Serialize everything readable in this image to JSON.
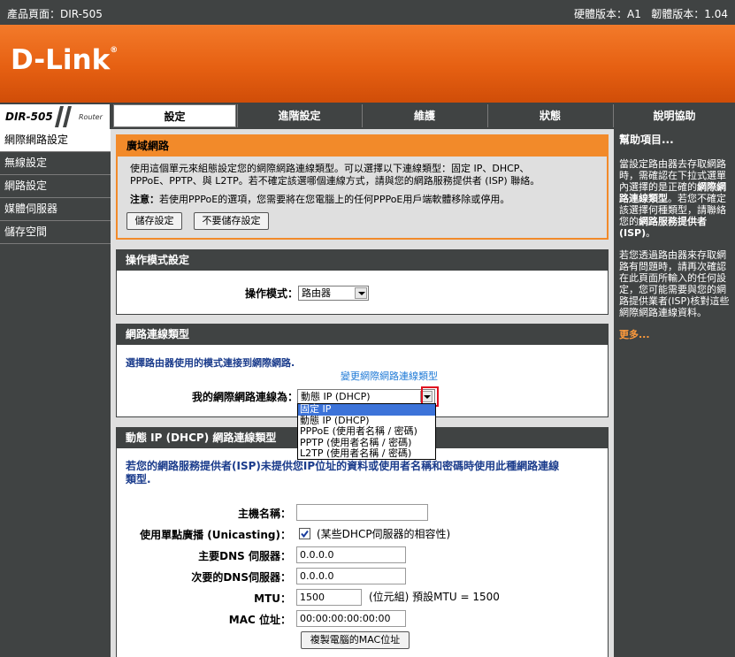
{
  "topbar": {
    "product_page": "產品頁面：DIR-505",
    "versions": "硬體版本：A1   韌體版本：1.04"
  },
  "brand": {
    "logo": "D-Link",
    "trademark": "®"
  },
  "model": {
    "name": "DIR-505",
    "subtitle": "Router"
  },
  "tabs": [
    {
      "label": "設定",
      "active": true
    },
    {
      "label": "進階設定",
      "active": false
    },
    {
      "label": "維護",
      "active": false
    },
    {
      "label": "狀態",
      "active": false
    },
    {
      "label": "說明協助",
      "active": false
    }
  ],
  "sidebar": {
    "items": [
      {
        "label": "網際網路設定",
        "active": true
      },
      {
        "label": "無線設定",
        "active": false
      },
      {
        "label": "網路設定",
        "active": false
      },
      {
        "label": "媒體伺服器",
        "active": false
      },
      {
        "label": "儲存空間",
        "active": false
      }
    ]
  },
  "wan": {
    "title": "廣域網路",
    "desc1": "使用這個單元來組態設定您的網際網路連線類型。可以選擇以下連線類型：固定 IP、DHCP、",
    "desc2": "PPPoE、PPTP、與 L2TP。若不確定該選哪個連線方式，請與您的網路服務提供者 (ISP) 聯絡。",
    "note_label": "注意：",
    "note_text": "若使用PPPoE的選項，您需要將在您電腦上的任何PPPoE用戶端軟體移除或停用。",
    "save_label": "儲存設定",
    "dont_save_label": "不要儲存設定"
  },
  "mode": {
    "title": "操作模式設定",
    "label": "操作模式：",
    "value": "路由器"
  },
  "conn": {
    "title": "網路連線類型",
    "desc": "選擇路由器使用的模式連接到網際網路.",
    "change_link": "變更網際網路連線類型",
    "label": "我的網際網路連線為：",
    "value": "動態 IP (DHCP)",
    "options": [
      {
        "label": "固定 IP",
        "highlighted": true
      },
      {
        "label": "動態 IP (DHCP)",
        "highlighted": false
      },
      {
        "label": "PPPoE (使用者名稱 / 密碼)",
        "highlighted": false
      },
      {
        "label": "PPTP (使用者名稱 / 密碼)",
        "highlighted": false
      },
      {
        "label": "L2TP (使用者名稱 / 密碼)",
        "highlighted": false
      }
    ]
  },
  "dhcp": {
    "title": "動態 IP (DHCP) 網路連線類型",
    "desc1": "若您的網路服務提供者(ISP)未提供您IP位址的資料或使用者名稱和密碼時使用此種網路連線",
    "desc2": "類型.",
    "host_label": "主機名稱：",
    "host_value": "",
    "unicast_label": "使用單點廣播 (Unicasting)：",
    "unicast_checked": true,
    "unicast_note": "(某些DHCP伺服器的相容性)",
    "dns1_label": "主要DNS 伺服器：",
    "dns1_value": "0.0.0.0",
    "dns2_label": "次要的DNS伺服器：",
    "dns2_value": "0.0.0.0",
    "mtu_label": "MTU：",
    "mtu_value": "1500",
    "mtu_note": "(位元組) 預設MTU = 1500",
    "mac_label": "MAC 位址：",
    "mac_value": "00:00:00:00:00:00",
    "clone_label": "複製電腦的MAC位址"
  },
  "help": {
    "title": "幫助項目...",
    "p1a": "當設定路由器去存取網路時，需確認在下拉式選單內選擇的是正確的",
    "p1b": "網際網路連線類型",
    "p1c": "。若您不確定該選擇何種類型，請聯絡您的",
    "p1d": "網路服務提供者(ISP)",
    "p1e": "。",
    "p2": "若您透過路由器來存取網路有問題時，請再次確認在此頁面所輸入的任何設定，您可能需要與您的網路提供業者(ISP)核對這些網際網路連線資料。",
    "more": "更多..."
  },
  "colors": {
    "banner_orange": "#e66012",
    "dark_gray": "#404343",
    "panel_orange": "#f28a2a",
    "highlight_red": "#e01020",
    "selection_blue": "#3c73d9"
  }
}
